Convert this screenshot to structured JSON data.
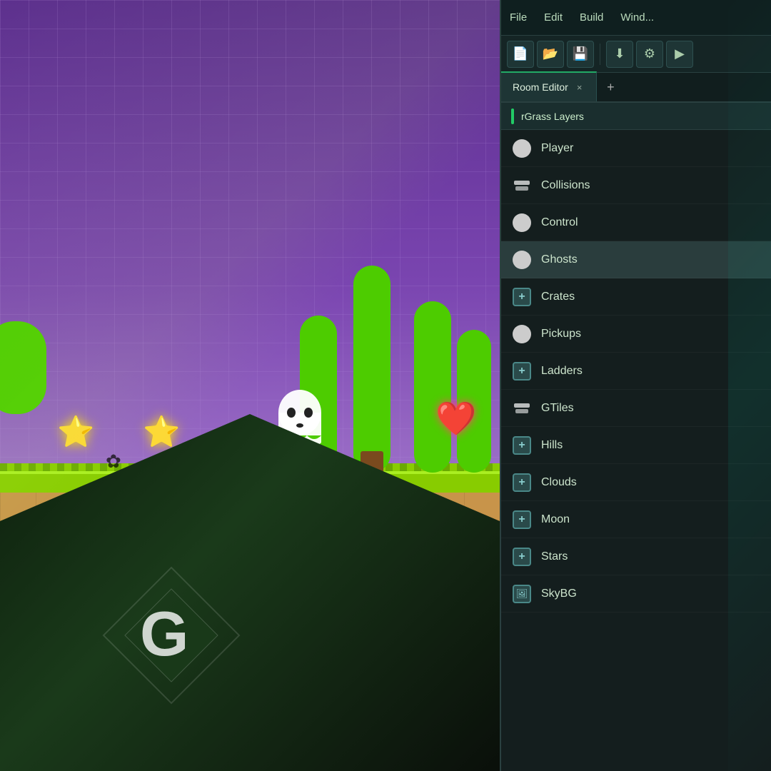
{
  "menu": {
    "items": [
      "File",
      "Edit",
      "Build",
      "Wind..."
    ]
  },
  "toolbar": {
    "buttons": [
      {
        "icon": "📄",
        "label": "new-file-icon"
      },
      {
        "icon": "📂",
        "label": "open-folder-icon"
      },
      {
        "icon": "💾",
        "label": "save-icon"
      },
      {
        "icon": "⬇",
        "label": "download-icon"
      },
      {
        "icon": "⚙",
        "label": "settings-icon"
      },
      {
        "icon": "▶",
        "label": "run-icon"
      }
    ]
  },
  "tab": {
    "label": "Room Editor",
    "close_label": "×",
    "add_label": "+"
  },
  "subheader": {
    "title": "rGrass Layers"
  },
  "layers": [
    {
      "name": "Player",
      "icon_type": "circle",
      "active": false
    },
    {
      "name": "Collisions",
      "icon_type": "layers",
      "active": false
    },
    {
      "name": "Control",
      "icon_type": "circle",
      "active": false
    },
    {
      "name": "Ghosts",
      "icon_type": "circle",
      "active": true
    },
    {
      "name": "Crates",
      "icon_type": "plus",
      "active": false
    },
    {
      "name": "Pickups",
      "icon_type": "circle",
      "active": false
    },
    {
      "name": "Ladders",
      "icon_type": "plus",
      "active": false
    },
    {
      "name": "GTiles",
      "icon_type": "layers",
      "active": false
    },
    {
      "name": "Hills",
      "icon_type": "plus",
      "active": false
    },
    {
      "name": "Clouds",
      "icon_type": "plus",
      "active": false
    },
    {
      "name": "Moon",
      "icon_type": "plus",
      "active": false
    },
    {
      "name": "Stars",
      "icon_type": "plus",
      "active": false
    },
    {
      "name": "SkyBG",
      "icon_type": "image",
      "active": false
    }
  ],
  "colors": {
    "accent": "#22aa66",
    "panel_bg": "#141e1e",
    "active_row": "#2a3d3d"
  }
}
